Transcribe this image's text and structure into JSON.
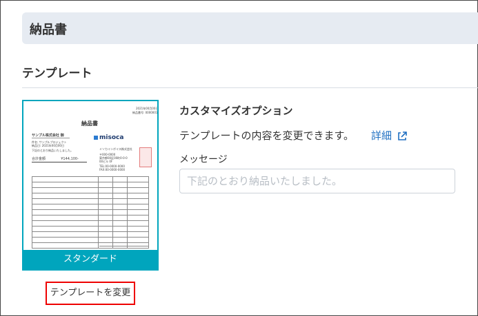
{
  "header": {
    "title": "納品書"
  },
  "section": {
    "title": "テンプレート"
  },
  "template": {
    "name": "スタンダード",
    "change_button": "テンプレートを変更",
    "preview": {
      "title": "納品書",
      "customer": "サンプル株式会社 御",
      "brand": "misoca"
    }
  },
  "options": {
    "title": "カスタマイズオプション",
    "description": "テンプレートの内容を変更できます。",
    "detail_link": "詳細",
    "message_label": "メッセージ",
    "message_placeholder": "下記のとおり納品いたしました。",
    "message_value": ""
  },
  "colors": {
    "accent": "#00a5bd",
    "link": "#1e6fc2",
    "highlight": "#ee0000"
  }
}
